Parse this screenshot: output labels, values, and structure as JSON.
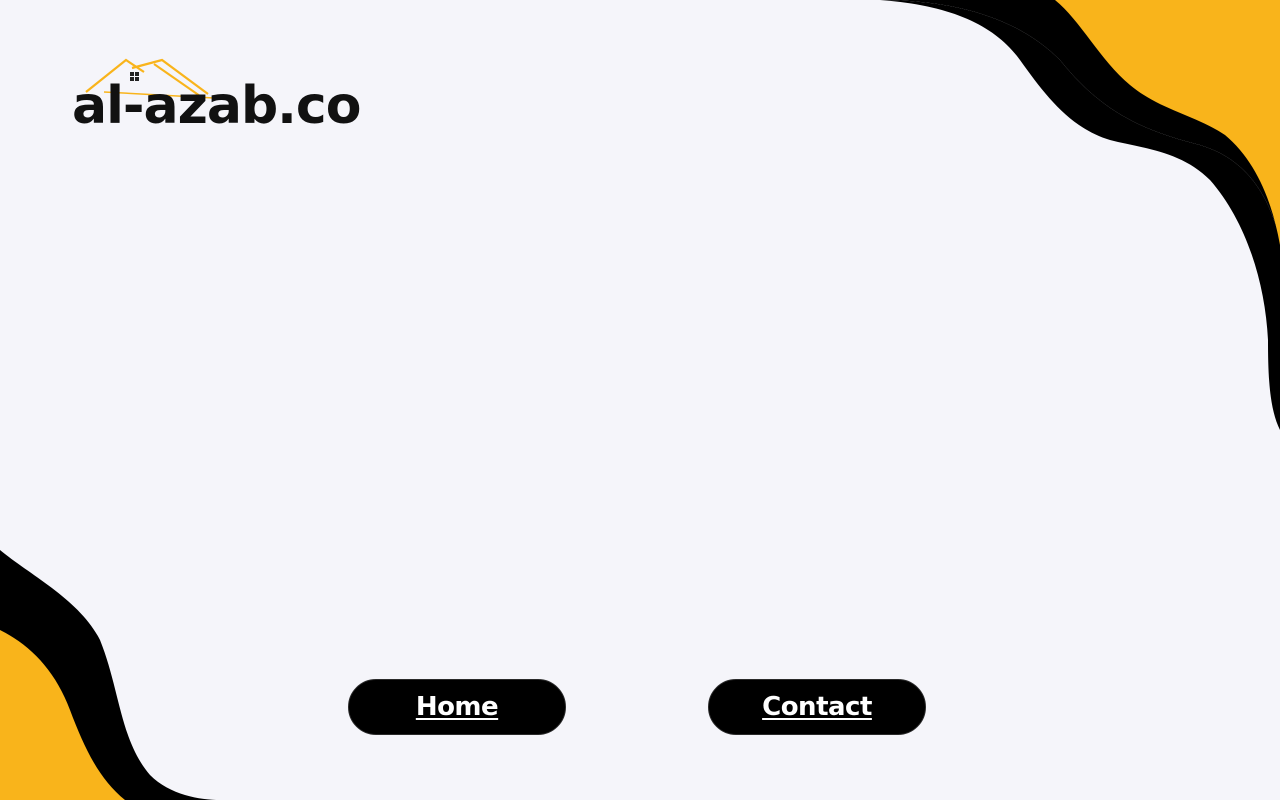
{
  "brand": {
    "logo_text": "al-azab.co",
    "logo_icon": "house-roof-icon"
  },
  "nav": {
    "home_label": "Home",
    "contact_label": "Contact"
  },
  "colors": {
    "background": "#f5f5fa",
    "accent_yellow": "#f9b41b",
    "blob_black": "#000000",
    "button_bg": "#000000",
    "button_text": "#ffffff"
  }
}
